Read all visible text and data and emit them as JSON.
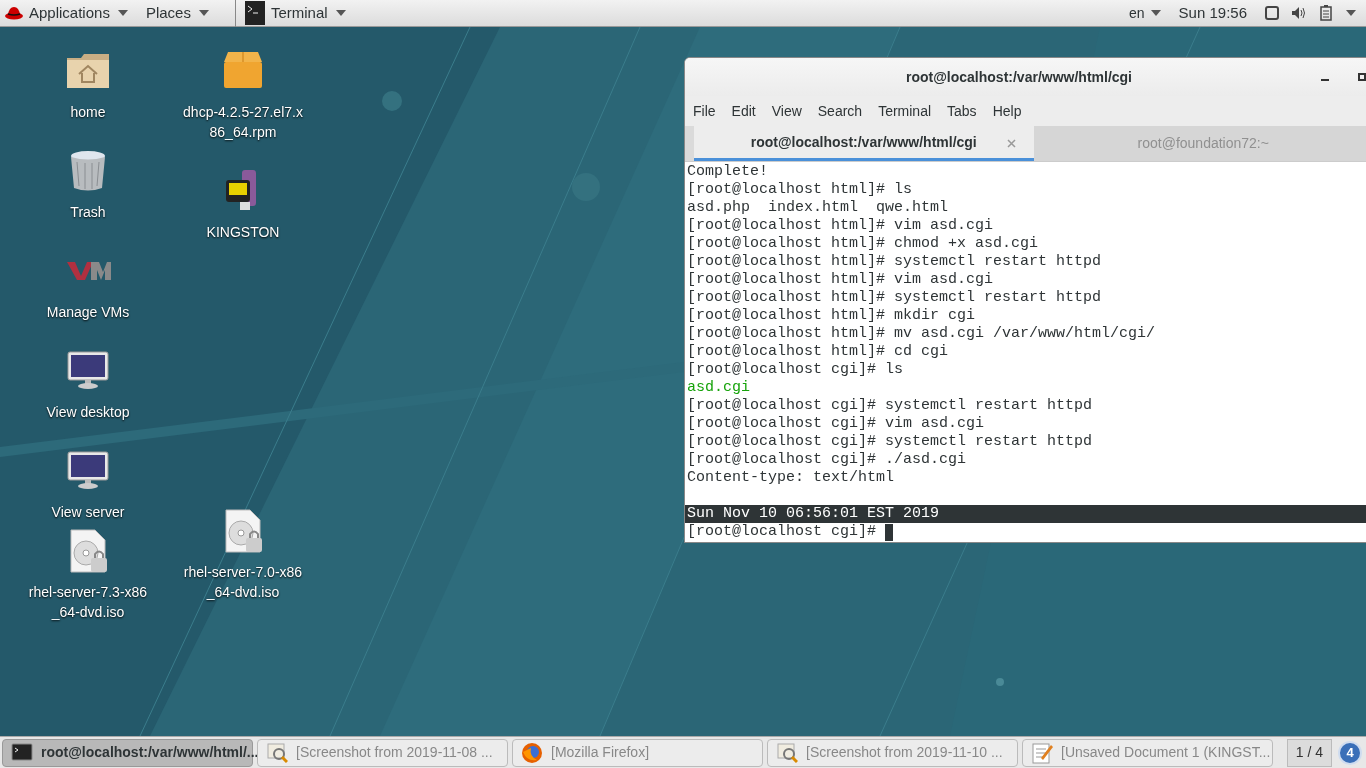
{
  "top_bar": {
    "menus": [
      {
        "label": "Applications"
      },
      {
        "label": "Places"
      },
      {
        "label": "Terminal"
      }
    ],
    "language": "en",
    "clock": "Sun 19:56"
  },
  "desktop_icons": [
    {
      "kind": "home",
      "label": "home"
    },
    {
      "kind": "package",
      "label": "dhcp-4.2.5-27.el7.x86_64.rpm"
    },
    {
      "kind": "trash",
      "label": "Trash"
    },
    {
      "kind": "drive",
      "label": "KINGSTON"
    },
    {
      "kind": "vm",
      "label": "Manage VMs"
    },
    {
      "kind": "monitor",
      "label": "View desktop"
    },
    {
      "kind": "monitor",
      "label": "View server"
    },
    {
      "kind": "disc",
      "label": "rhel-server-7.0-x86_64-dvd.iso"
    },
    {
      "kind": "disc",
      "label": "rhel-server-7.3-x86_64-dvd.iso"
    }
  ],
  "terminal": {
    "title": "root@localhost:/var/www/html/cgi",
    "menu": [
      "File",
      "Edit",
      "View",
      "Search",
      "Terminal",
      "Tabs",
      "Help"
    ],
    "tabs": [
      {
        "label": "root@localhost:/var/www/html/cgi",
        "selected": true
      },
      {
        "label": "root@foundation72:~",
        "selected": false
      }
    ],
    "lines": [
      {
        "kind": "plain",
        "text": "Complete!"
      },
      {
        "kind": "plain",
        "text": "[root@localhost html]# ls"
      },
      {
        "kind": "plain",
        "text": "asd.php  index.html  qwe.html"
      },
      {
        "kind": "plain",
        "text": "[root@localhost html]# vim asd.cgi"
      },
      {
        "kind": "plain",
        "text": "[root@localhost html]# chmod +x asd.cgi"
      },
      {
        "kind": "plain",
        "text": "[root@localhost html]# systemctl restart httpd"
      },
      {
        "kind": "plain",
        "text": "[root@localhost html]# vim asd.cgi"
      },
      {
        "kind": "plain",
        "text": "[root@localhost html]# systemctl restart httpd"
      },
      {
        "kind": "plain",
        "text": "[root@localhost html]# mkdir cgi"
      },
      {
        "kind": "plain",
        "text": "[root@localhost html]# mv asd.cgi /var/www/html/cgi/"
      },
      {
        "kind": "plain",
        "text": "[root@localhost html]# cd cgi"
      },
      {
        "kind": "plain",
        "text": "[root@localhost cgi]# ls"
      },
      {
        "kind": "executable",
        "text": "asd.cgi"
      },
      {
        "kind": "plain",
        "text": "[root@localhost cgi]# systemctl restart httpd"
      },
      {
        "kind": "plain",
        "text": "[root@localhost cgi]# vim asd.cgi"
      },
      {
        "kind": "plain",
        "text": "[root@localhost cgi]# systemctl restart httpd"
      },
      {
        "kind": "plain",
        "text": "[root@localhost cgi]# ./asd.cgi"
      },
      {
        "kind": "plain",
        "text": "Content-type: text/html"
      },
      {
        "kind": "selected",
        "text": "Sun Nov 10 06:56:01 EST 2019",
        "gap_before": true
      },
      {
        "kind": "plain",
        "text": "[root@localhost cgi]# ",
        "cursor": true
      }
    ]
  },
  "taskbar": {
    "items": [
      {
        "kind": "terminal",
        "label": "root@localhost:/var/www/html/...",
        "selected": true
      },
      {
        "kind": "viewer",
        "label": "[Screenshot from 2019-11-08 ...",
        "selected": false
      },
      {
        "kind": "firefox",
        "label": "[Mozilla Firefox]",
        "selected": false
      },
      {
        "kind": "viewer",
        "label": "[Screenshot from 2019-11-10 ...",
        "selected": false
      },
      {
        "kind": "editor",
        "label": "[Unsaved Document 1 (KINGST...",
        "selected": false
      }
    ],
    "workspace": "1 / 4",
    "badge": "4"
  }
}
